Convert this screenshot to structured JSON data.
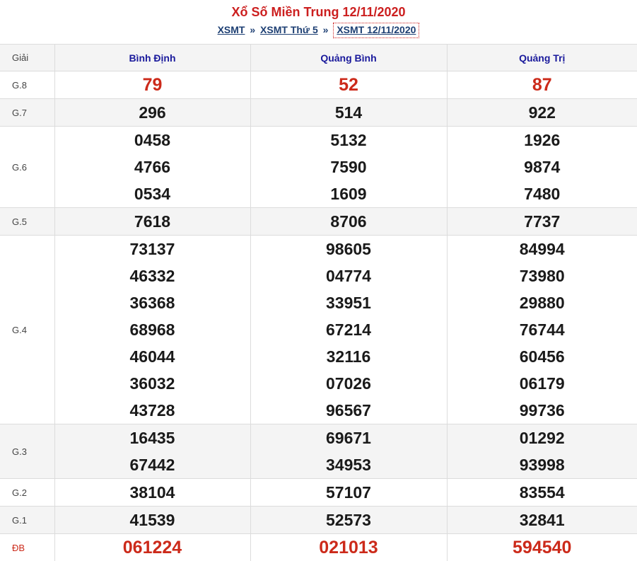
{
  "header": {
    "title": "Xổ Số Miền Trung 12/11/2020",
    "breadcrumb": [
      "XSMT",
      "XSMT Thứ 5",
      "XSMT 12/11/2020"
    ],
    "separator": "»"
  },
  "table": {
    "label_header": "Giải",
    "provinces": [
      "Bình Định",
      "Quảng Bình",
      "Quảng Trị"
    ],
    "rows": [
      {
        "label": "G.8",
        "cols": [
          [
            "79"
          ],
          [
            "52"
          ],
          [
            "87"
          ]
        ]
      },
      {
        "label": "G.7",
        "cols": [
          [
            "296"
          ],
          [
            "514"
          ],
          [
            "922"
          ]
        ]
      },
      {
        "label": "G.6",
        "cols": [
          [
            "0458",
            "4766",
            "0534"
          ],
          [
            "5132",
            "7590",
            "1609"
          ],
          [
            "1926",
            "9874",
            "7480"
          ]
        ]
      },
      {
        "label": "G.5",
        "cols": [
          [
            "7618"
          ],
          [
            "8706"
          ],
          [
            "7737"
          ]
        ]
      },
      {
        "label": "G.4",
        "cols": [
          [
            "73137",
            "46332",
            "36368",
            "68968",
            "46044",
            "36032",
            "43728"
          ],
          [
            "98605",
            "04774",
            "33951",
            "67214",
            "32116",
            "07026",
            "96567"
          ],
          [
            "84994",
            "73980",
            "29880",
            "76744",
            "60456",
            "06179",
            "99736"
          ]
        ]
      },
      {
        "label": "G.3",
        "cols": [
          [
            "16435",
            "67442"
          ],
          [
            "69671",
            "34953"
          ],
          [
            "01292",
            "93998"
          ]
        ]
      },
      {
        "label": "G.2",
        "cols": [
          [
            "38104"
          ],
          [
            "57107"
          ],
          [
            "83554"
          ]
        ]
      },
      {
        "label": "G.1",
        "cols": [
          [
            "41539"
          ],
          [
            "52573"
          ],
          [
            "32841"
          ]
        ]
      },
      {
        "label": "ĐB",
        "cols": [
          [
            "061224"
          ],
          [
            "021013"
          ],
          [
            "594540"
          ]
        ]
      }
    ]
  },
  "colors": {
    "title": "#cc1f1f",
    "link": "#1d3f73",
    "province": "#1a1a9c",
    "highlight_number": "#cc2a1a",
    "row_alt_bg": "#f4f4f4"
  }
}
